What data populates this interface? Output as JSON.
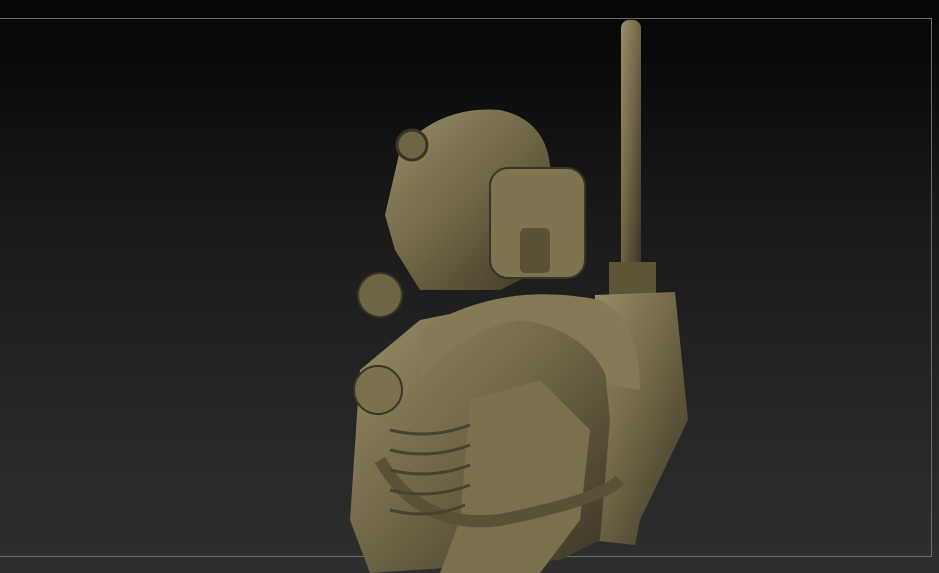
{
  "viewport": {
    "background_top": "#050505",
    "background_bottom": "#2f2f2f",
    "frame_color": "#6a6a6a",
    "model_color": "#6e6446",
    "model_highlight": "#9a8f68",
    "model_shadow": "#3a3424"
  }
}
